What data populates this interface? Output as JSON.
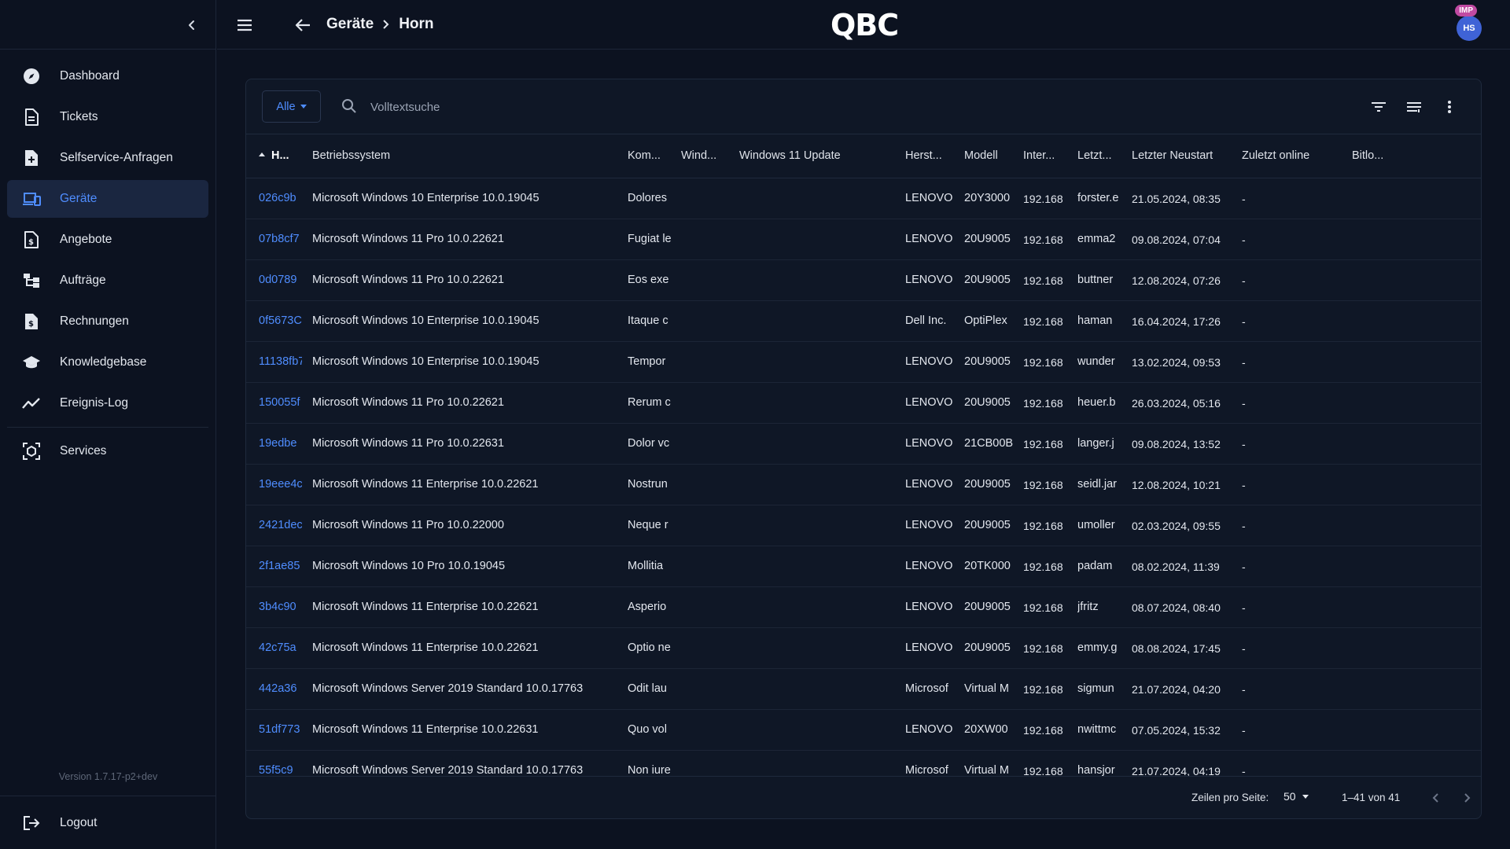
{
  "sidebar": {
    "items": [
      {
        "label": "Dashboard",
        "icon": "compass-icon",
        "active": false
      },
      {
        "label": "Tickets",
        "icon": "document-icon",
        "active": false
      },
      {
        "label": "Selfservice-Anfragen",
        "icon": "document-plus-icon",
        "active": false
      },
      {
        "label": "Geräte",
        "icon": "devices-icon",
        "active": true
      },
      {
        "label": "Angebote",
        "icon": "document-euro-icon",
        "active": false
      },
      {
        "label": "Aufträge",
        "icon": "hierarchy-icon",
        "active": false
      },
      {
        "label": "Rechnungen",
        "icon": "invoice-icon",
        "active": false
      },
      {
        "label": "Knowledgebase",
        "icon": "graduation-cap-icon",
        "active": false
      },
      {
        "label": "Ereignis-Log",
        "icon": "trend-line-icon",
        "active": false
      }
    ],
    "services_label": "Services",
    "version": "Version 1.7.17-p2+dev",
    "logout_label": "Logout"
  },
  "header": {
    "breadcrumb": [
      "Geräte",
      "Horn"
    ],
    "logo": "QBC",
    "avatar_initials": "HS",
    "imp_badge": "IMP"
  },
  "toolbar": {
    "filter_value": "Alle",
    "search_placeholder": "Volltextsuche"
  },
  "table": {
    "columns": [
      "H...",
      "Betriebssystem",
      "Kom...",
      "Wind...",
      "Windows 11 Update",
      "Herst...",
      "Modell",
      "Inter...",
      "Letzt...",
      "Letzter Neustart",
      "Zuletzt online",
      "Bitlo..."
    ],
    "rows": [
      [
        "026c9b",
        "Microsoft Windows 10 Enterprise 10.0.19045",
        "Dolores",
        "",
        "",
        "LENOVO",
        "20Y3000",
        "192.168",
        "forster.e",
        "21.05.2024, 08:35",
        "-",
        ""
      ],
      [
        "07b8cf7",
        "Microsoft Windows 11 Pro 10.0.22621",
        "Fugiat le",
        "",
        "",
        "LENOVO",
        "20U9005",
        "192.168",
        "emma2",
        "09.08.2024, 07:04",
        "-",
        ""
      ],
      [
        "0d0789",
        "Microsoft Windows 11 Pro 10.0.22621",
        "Eos exe",
        "",
        "",
        "LENOVO",
        "20U9005",
        "192.168",
        "buttner",
        "12.08.2024, 07:26",
        "-",
        ""
      ],
      [
        "0f5673C",
        "Microsoft Windows 10 Enterprise 10.0.19045",
        "Itaque c",
        "",
        "",
        "Dell Inc.",
        "OptiPlex",
        "192.168",
        "haman",
        "16.04.2024, 17:26",
        "-",
        ""
      ],
      [
        "11138fb7",
        "Microsoft Windows 10 Enterprise 10.0.19045",
        "Tempor",
        "",
        "",
        "LENOVO",
        "20U9005",
        "192.168",
        "wunder",
        "13.02.2024, 09:53",
        "-",
        ""
      ],
      [
        "150055f",
        "Microsoft Windows 11 Pro 10.0.22621",
        "Rerum c",
        "",
        "",
        "LENOVO",
        "20U9005",
        "192.168",
        "heuer.b",
        "26.03.2024, 05:16",
        "-",
        ""
      ],
      [
        "19edbe",
        "Microsoft Windows 11 Pro 10.0.22631",
        "Dolor vc",
        "",
        "",
        "LENOVO",
        "21CB00B",
        "192.168",
        "langer.j",
        "09.08.2024, 13:52",
        "-",
        ""
      ],
      [
        "19eee4c",
        "Microsoft Windows 11 Enterprise 10.0.22621",
        "Nostrun",
        "",
        "",
        "LENOVO",
        "20U9005",
        "192.168",
        "seidl.jar",
        "12.08.2024, 10:21",
        "-",
        ""
      ],
      [
        "2421dec",
        "Microsoft Windows 11 Pro 10.0.22000",
        "Neque r",
        "",
        "",
        "LENOVO",
        "20U9005",
        "192.168",
        "umoller",
        "02.03.2024, 09:55",
        "-",
        ""
      ],
      [
        "2f1ae85",
        "Microsoft Windows 10 Pro 10.0.19045",
        "Mollitia",
        "",
        "",
        "LENOVO",
        "20TK000",
        "192.168",
        "padam",
        "08.02.2024, 11:39",
        "-",
        ""
      ],
      [
        "3b4c90",
        "Microsoft Windows 11 Enterprise 10.0.22621",
        "Asperio",
        "",
        "",
        "LENOVO",
        "20U9005",
        "192.168",
        "jfritz",
        "08.07.2024, 08:40",
        "-",
        ""
      ],
      [
        "42c75a",
        "Microsoft Windows 11 Enterprise 10.0.22621",
        "Optio ne",
        "",
        "",
        "LENOVO",
        "20U9005",
        "192.168",
        "emmy.g",
        "08.08.2024, 17:45",
        "-",
        ""
      ],
      [
        "442a36",
        "Microsoft Windows Server 2019 Standard 10.0.17763",
        "Odit lau",
        "",
        "",
        "Microsof",
        "Virtual M",
        "192.168",
        "sigmun",
        "21.07.2024, 04:20",
        "-",
        ""
      ],
      [
        "51df773",
        "Microsoft Windows 11 Enterprise 10.0.22631",
        "Quo vol",
        "",
        "",
        "LENOVO",
        "20XW00",
        "192.168",
        "nwittmc",
        "07.05.2024, 15:32",
        "-",
        ""
      ],
      [
        "55f5c9",
        "Microsoft Windows Server 2019 Standard 10.0.17763",
        "Non iure",
        "",
        "",
        "Microsof",
        "Virtual M",
        "192.168",
        "hansjor",
        "21.07.2024, 04:19",
        "-",
        ""
      ]
    ]
  },
  "footer": {
    "rows_per_page_label": "Zeilen pro Seite:",
    "rows_per_page_value": "50",
    "range_label": "1–41 von 41"
  },
  "colors": {
    "accent": "#4f8dff",
    "background": "#0c1220",
    "card": "#0f1726",
    "badge": "#c04aa2",
    "avatar": "#3f63d6"
  }
}
